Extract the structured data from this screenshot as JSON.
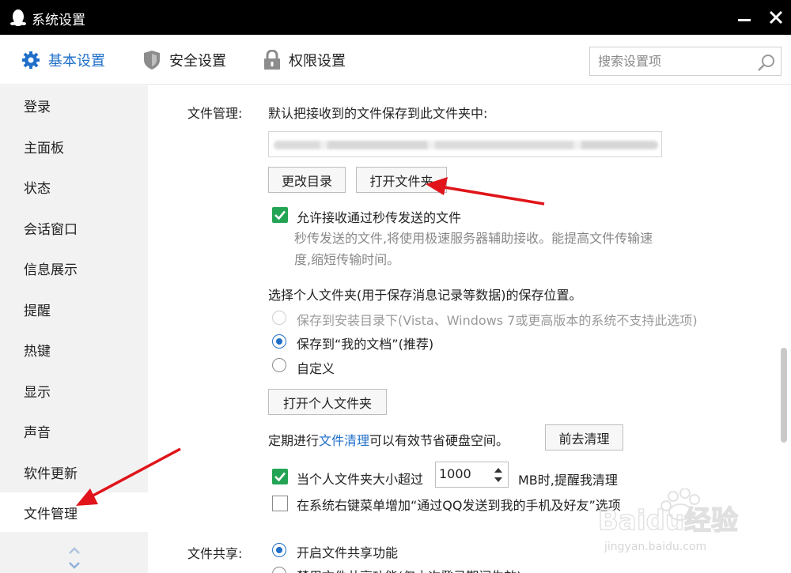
{
  "window": {
    "title": "系统设置"
  },
  "toolbar": {
    "tabs": [
      {
        "label": "基本设置",
        "icon": "gear-icon"
      },
      {
        "label": "安全设置",
        "icon": "shield-icon"
      },
      {
        "label": "权限设置",
        "icon": "lock-icon"
      }
    ],
    "search_placeholder": "搜索设置项"
  },
  "sidebar": {
    "items": [
      {
        "label": "登录"
      },
      {
        "label": "主面板"
      },
      {
        "label": "状态"
      },
      {
        "label": "会话窗口"
      },
      {
        "label": "信息展示"
      },
      {
        "label": "提醒"
      },
      {
        "label": "热键"
      },
      {
        "label": "显示"
      },
      {
        "label": "声音"
      },
      {
        "label": "软件更新"
      },
      {
        "label": "文件管理"
      }
    ],
    "active": "文件管理"
  },
  "file_mgmt": {
    "section_label": "文件管理:",
    "default_folder_text": "默认把接收到的文件保存到此文件夹中:",
    "change_dir_label": "更改目录",
    "open_folder_label": "打开文件夹",
    "allow_fast_label": "允许接收通过秒传发送的文件",
    "allow_fast_checked": true,
    "fast_desc_line1": "秒传发送的文件,将使用极速服务器辅助接收。能提高文件传输速",
    "fast_desc_line2": "度,缩短传输时间。",
    "personal_folder_text": "选择个人文件夹(用于保存消息记录等数据)的保存位置。",
    "radio_options": [
      {
        "label": "保存到安装目录下(Vista、Windows 7或更高版本的系统不支持此选项)",
        "state": "disabled"
      },
      {
        "label": "保存到“我的文档”(推荐)",
        "state": "selected"
      },
      {
        "label": "自定义",
        "state": "unselected"
      }
    ],
    "open_personal_label": "打开个人文件夹",
    "cleanup_prefix": "定期进行",
    "cleanup_link": "文件清理",
    "cleanup_suffix": "可以有效节省硬盘空间。",
    "cleanup_button_label": "前去清理",
    "size_check_label": "当个人文件夹大小超过",
    "size_check_checked": true,
    "size_value": "1000",
    "size_suffix": "MB时,提醒我清理",
    "context_menu_label": "在系统右键菜单增加“通过QQ发送到我的手机及好友”选项",
    "context_menu_checked": false
  },
  "file_share": {
    "section_label": "文件共享:",
    "options": [
      {
        "label": "开启文件共享功能",
        "state": "selected"
      },
      {
        "label": "禁用文件共享功能(仅本次登录期间生效)",
        "state": "unselected"
      }
    ]
  },
  "watermark": {
    "brand": "Baidu经验",
    "url": "jingyan.baidu.com"
  },
  "colors": {
    "accent": "#1f6fc9",
    "check": "#23a455",
    "arrow": "#e0141a"
  }
}
